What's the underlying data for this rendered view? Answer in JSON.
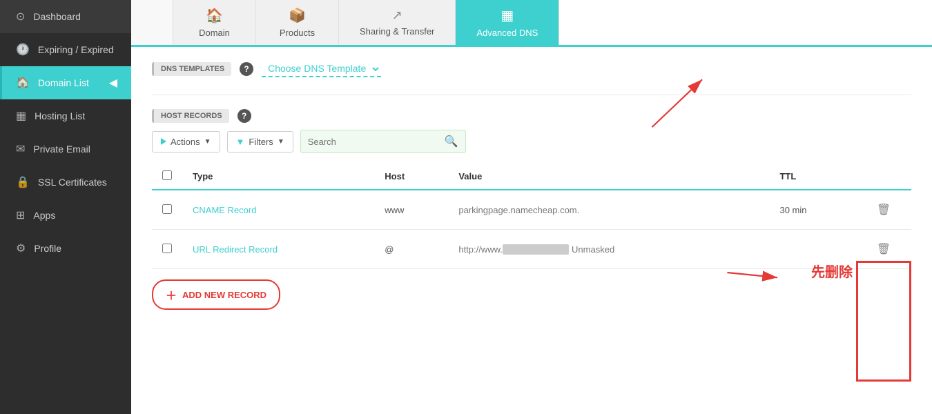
{
  "sidebar": {
    "items": [
      {
        "id": "dashboard",
        "label": "Dashboard",
        "icon": "⊙"
      },
      {
        "id": "expiring",
        "label": "Expiring / Expired",
        "icon": "🕐"
      },
      {
        "id": "domain-list",
        "label": "Domain List",
        "icon": "🏠",
        "active": true
      },
      {
        "id": "hosting-list",
        "label": "Hosting List",
        "icon": "▦"
      },
      {
        "id": "private-email",
        "label": "Private Email",
        "icon": "✉"
      },
      {
        "id": "ssl-certificates",
        "label": "SSL Certificates",
        "icon": "🔒"
      },
      {
        "id": "apps",
        "label": "Apps",
        "icon": "⊞"
      },
      {
        "id": "profile",
        "label": "Profile",
        "icon": "⚙"
      }
    ]
  },
  "tabs": [
    {
      "id": "empty",
      "label": "",
      "icon": ""
    },
    {
      "id": "domain",
      "label": "Domain",
      "icon": "🏠"
    },
    {
      "id": "products",
      "label": "Products",
      "icon": "📦"
    },
    {
      "id": "sharing-transfer",
      "label": "Sharing & Transfer",
      "icon": "↗"
    },
    {
      "id": "advanced-dns",
      "label": "Advanced DNS",
      "icon": "▦",
      "active": true
    }
  ],
  "dns_templates": {
    "label": "DNS TEMPLATES",
    "placeholder": "Choose DNS Template",
    "help": "?"
  },
  "host_records": {
    "label": "HOST RECORDS",
    "help": "?"
  },
  "toolbar": {
    "actions_label": "Actions",
    "filters_label": "Filters",
    "search_placeholder": "Search"
  },
  "table": {
    "columns": [
      "Type",
      "Host",
      "Value",
      "TTL"
    ],
    "rows": [
      {
        "type": "CNAME Record",
        "host": "www",
        "value": "parkingpage.namecheap.com.",
        "ttl": "30 min"
      },
      {
        "type": "URL Redirect Record",
        "host": "@",
        "value": "http://www.",
        "value_masked": "██████████",
        "value_suffix": "Unmasked",
        "ttl": ""
      }
    ]
  },
  "add_record": {
    "label": "ADD NEW RECORD"
  },
  "annotation": {
    "chinese_label": "先删除"
  }
}
